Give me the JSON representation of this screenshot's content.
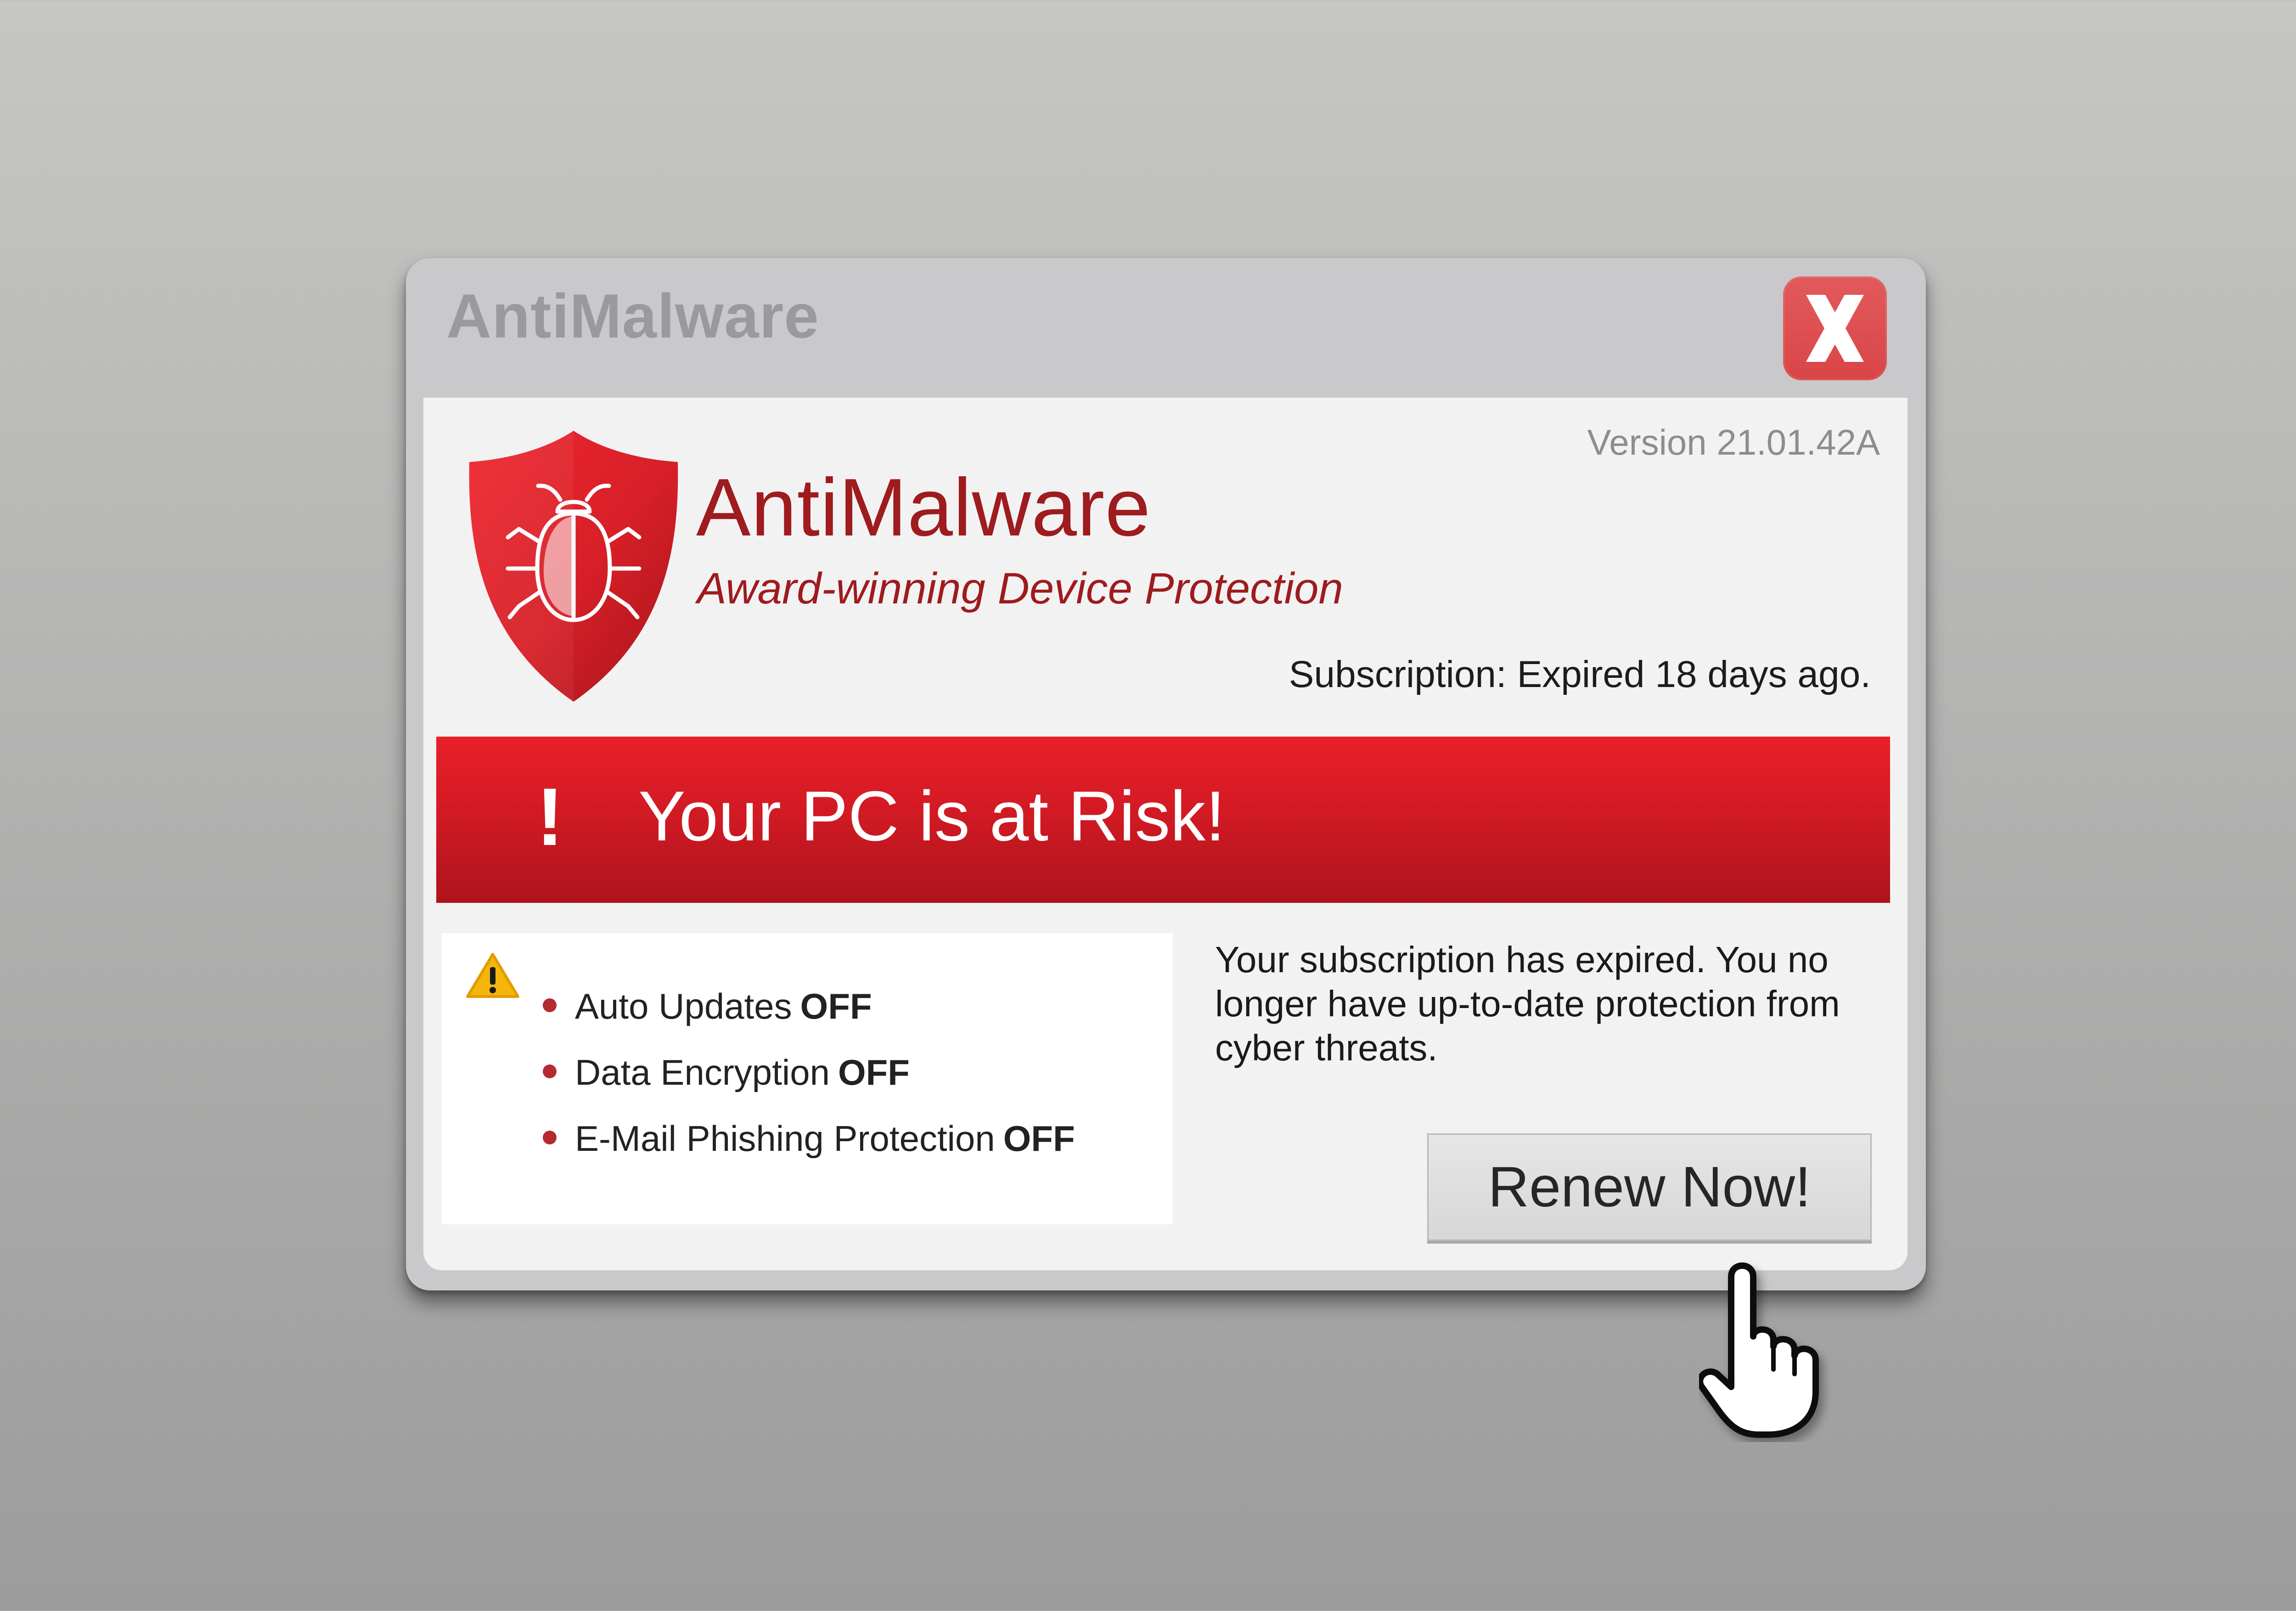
{
  "window": {
    "title": "AntiMalware"
  },
  "header": {
    "version": "Version 21.01.42A",
    "brand_name": "AntiMalware",
    "tagline": "Award-winning Device Protection",
    "subscription": "Subscription: Expired 18 days ago."
  },
  "banner": {
    "icon": "!",
    "text": "Your PC is at Risk!"
  },
  "status": {
    "items": [
      {
        "label": "Auto Updates",
        "state": "OFF"
      },
      {
        "label": "Data Encryption",
        "state": "OFF"
      },
      {
        "label": "E-Mail Phishing Protection",
        "state": "OFF"
      }
    ]
  },
  "message": "Your subscription has expired. You no longer have up-to-date protection from cyber threats.",
  "renew_button": "Renew Now!",
  "icons": {
    "close": "close-icon",
    "logo": "bug-shield-icon",
    "warning": "warning-icon",
    "cursor": "hand-pointer-icon"
  },
  "colors": {
    "brand_red": "#9e1b1e",
    "banner_red": "#d21a24",
    "close_red": "#dd4b4d",
    "window_gray": "#c9c8ca",
    "warning_yellow": "#f5b50c"
  }
}
